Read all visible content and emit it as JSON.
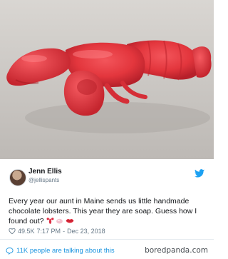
{
  "photo": {
    "subject": "red-lobster-shaped-soap"
  },
  "tweet": {
    "author_name": "Jenn Ellis",
    "author_handle": "@jellispants",
    "text": "Every year our aunt in Maine sends us little handmade chocolate lobsters. This year they are soap. Guess how I found out? ",
    "emoji": [
      "lobster-emoji",
      "soap-emoji",
      "lips-emoji"
    ],
    "likes": "49.5K",
    "time": "7:17 PM",
    "separator": "-",
    "date": "Dec 23, 2018"
  },
  "footer": {
    "talk_label": "11K people are talking about this",
    "watermark": "boredpanda.com"
  },
  "colors": {
    "twitter_blue": "#1da1f2",
    "link_blue": "#1b95e0",
    "text_gray": "#657786",
    "lobster_red": "#e0353d"
  }
}
